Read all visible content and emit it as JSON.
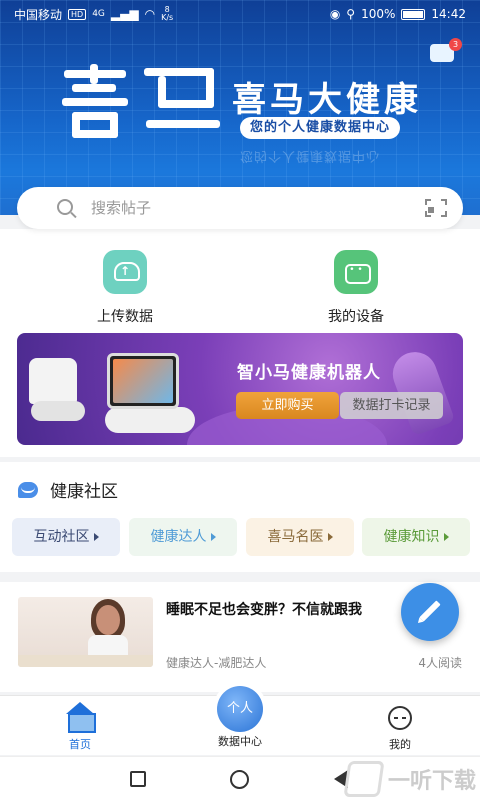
{
  "status_bar": {
    "carrier": "中国移动",
    "hd": "HD",
    "signal": "4G",
    "speed_value": "8",
    "speed_unit": "K/s",
    "battery": "100%",
    "time": "14:42"
  },
  "header": {
    "message_badge": "3",
    "brand_title": "喜马大健康",
    "brand_subtitle": "您的个人健康数据中心"
  },
  "search": {
    "placeholder": "搜索帖子"
  },
  "quick_actions": [
    {
      "label": "上传数据",
      "icon": "cloud-upload-icon"
    },
    {
      "label": "我的设备",
      "icon": "robot-device-icon"
    }
  ],
  "robot_banner": {
    "title": "智小马健康机器人",
    "buy_label": "立即购买",
    "log_label": "数据打卡记录"
  },
  "community": {
    "title": "健康社区",
    "chips": [
      "互动社区",
      "健康达人",
      "喜马名医",
      "健康知识"
    ]
  },
  "post": {
    "title": "睡眠不足也会变胖？不信就跟我",
    "meta": "健康达人-减肥达人",
    "reads": "4人阅读"
  },
  "tabbar": {
    "home": "首页",
    "center_ball": "个人",
    "center": "数据中心",
    "mine": "我的"
  },
  "watermark": "一听下载",
  "colors": {
    "header_blue": "#1665c9",
    "accent_blue": "#1e6fd9",
    "buy_orange": "#e8952b",
    "fab_blue": "#3d8fe6"
  }
}
